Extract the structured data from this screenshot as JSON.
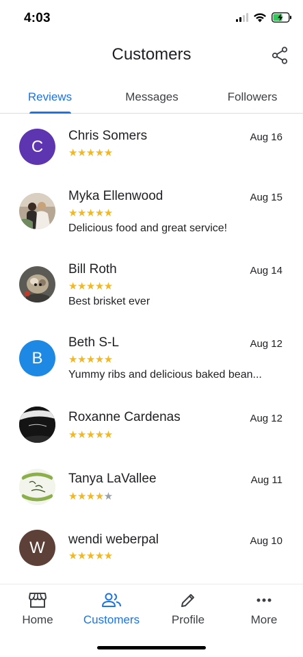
{
  "status_bar": {
    "time": "4:03"
  },
  "header": {
    "title": "Customers",
    "share_icon": "share-icon"
  },
  "tabs": [
    {
      "label": "Reviews",
      "active": true
    },
    {
      "label": "Messages",
      "active": false
    },
    {
      "label": "Followers",
      "active": false
    }
  ],
  "reviews": [
    {
      "name": "Chris Somers",
      "date": "Aug 16",
      "rating": 5,
      "comment": "",
      "avatar_initial": "C",
      "avatar_color": "#5e35b1"
    },
    {
      "name": "Myka Ellenwood",
      "date": "Aug 15",
      "rating": 5,
      "comment": "Delicious food and great service!",
      "avatar_initial": "",
      "avatar_color": "#8d7b6a"
    },
    {
      "name": "Bill Roth",
      "date": "Aug 14",
      "rating": 5,
      "comment": "Best brisket ever",
      "avatar_initial": "",
      "avatar_color": "#6e6a63"
    },
    {
      "name": "Beth S-L",
      "date": "Aug 12",
      "rating": 5,
      "comment": "Yummy ribs and delicious baked bean...",
      "avatar_initial": "B",
      "avatar_color": "#1e88e5"
    },
    {
      "name": "Roxanne Cardenas",
      "date": "Aug 12",
      "rating": 5,
      "comment": "",
      "avatar_initial": "",
      "avatar_color": "#1b1b1b"
    },
    {
      "name": "Tanya LaVallee",
      "date": "Aug 11",
      "rating": 4,
      "comment": "",
      "avatar_initial": "",
      "avatar_color": "#eef2e4"
    },
    {
      "name": "wendi weberpal",
      "date": "Aug 10",
      "rating": 5,
      "comment": "",
      "avatar_initial": "W",
      "avatar_color": "#5d4037"
    }
  ],
  "bottom_nav": [
    {
      "label": "Home",
      "icon": "storefront-icon",
      "active": false
    },
    {
      "label": "Customers",
      "icon": "people-icon",
      "active": true
    },
    {
      "label": "Profile",
      "icon": "pencil-icon",
      "active": false
    },
    {
      "label": "More",
      "icon": "more-dots-icon",
      "active": false
    }
  ],
  "colors": {
    "accent": "#1a73e8",
    "star": "#f2b824",
    "star_empty": "#9aa0a6"
  }
}
